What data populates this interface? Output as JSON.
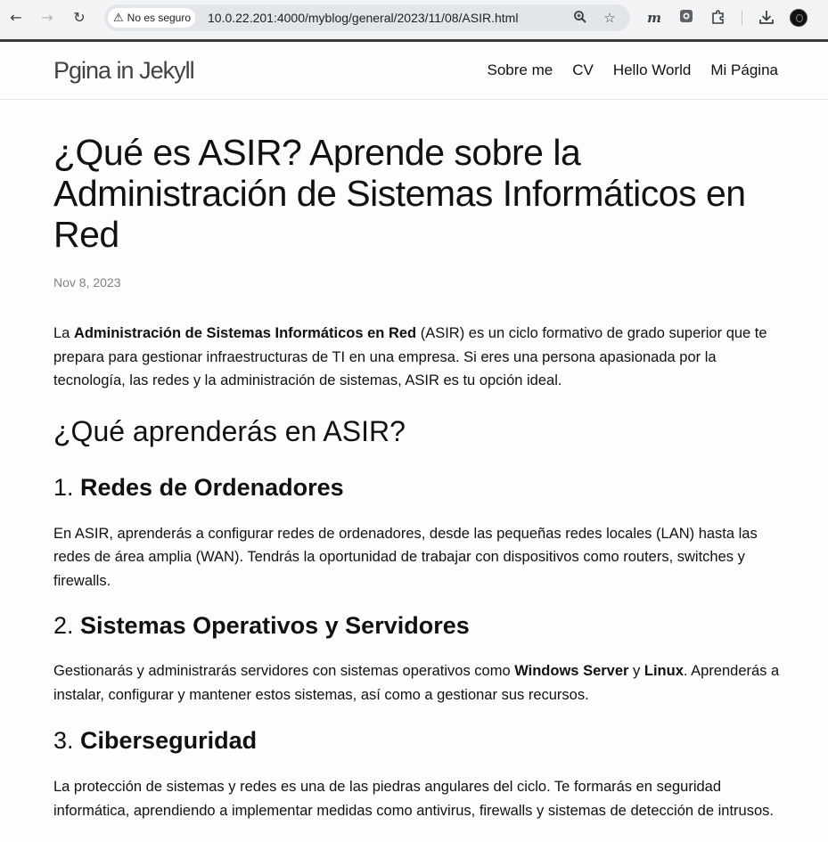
{
  "browser": {
    "security_label": "No es seguro",
    "url": "10.0.22.201:4000/myblog/general/2023/11/08/ASIR.html",
    "ext_m_label": "m"
  },
  "site": {
    "title": "Pgina in Jekyll",
    "nav": [
      "Sobre me",
      "CV",
      "Hello World",
      "Mi Página"
    ]
  },
  "post": {
    "title": "¿Qué es ASIR? Aprende sobre la Administración de Sistemas Informáticos en Red",
    "date": "Nov 8, 2023",
    "intro": {
      "pre": "La ",
      "bold": "Administración de Sistemas Informáticos en Red",
      "post": " (ASIR) es un ciclo formativo de grado superior que te prepara para gestionar infraestructuras de TI en una empresa. Si eres una persona apasionada por la tecnología, las redes y la administración de sistemas, ASIR es tu opción ideal."
    },
    "section_heading": "¿Qué aprenderás en ASIR?",
    "sections": [
      {
        "number": "1. ",
        "title": "Redes de Ordenadores",
        "body": "En ASIR, aprenderás a configurar redes de ordenadores, desde las pequeñas redes locales (LAN) hasta las redes de área amplia (WAN). Tendrás la oportunidad de trabajar con dispositivos como routers, switches y firewalls."
      },
      {
        "number": "2. ",
        "title": "Sistemas Operativos y Servidores",
        "body_pre": "Gestionarás y administrarás servidores con sistemas operativos como ",
        "body_bold1": "Windows Server",
        "body_mid": " y ",
        "body_bold2": "Linux",
        "body_post": ". Aprenderás a instalar, configurar y mantener estos sistemas, así como a gestionar sus recursos."
      },
      {
        "number": "3. ",
        "title": "Ciberseguridad",
        "body": "La protección de sistemas y redes es una de las piedras angulares del ciclo. Te formarás en seguridad informática, aprendiendo a implementar medidas como antivirus, firewalls y sistemas de detección de intrusos."
      }
    ]
  }
}
